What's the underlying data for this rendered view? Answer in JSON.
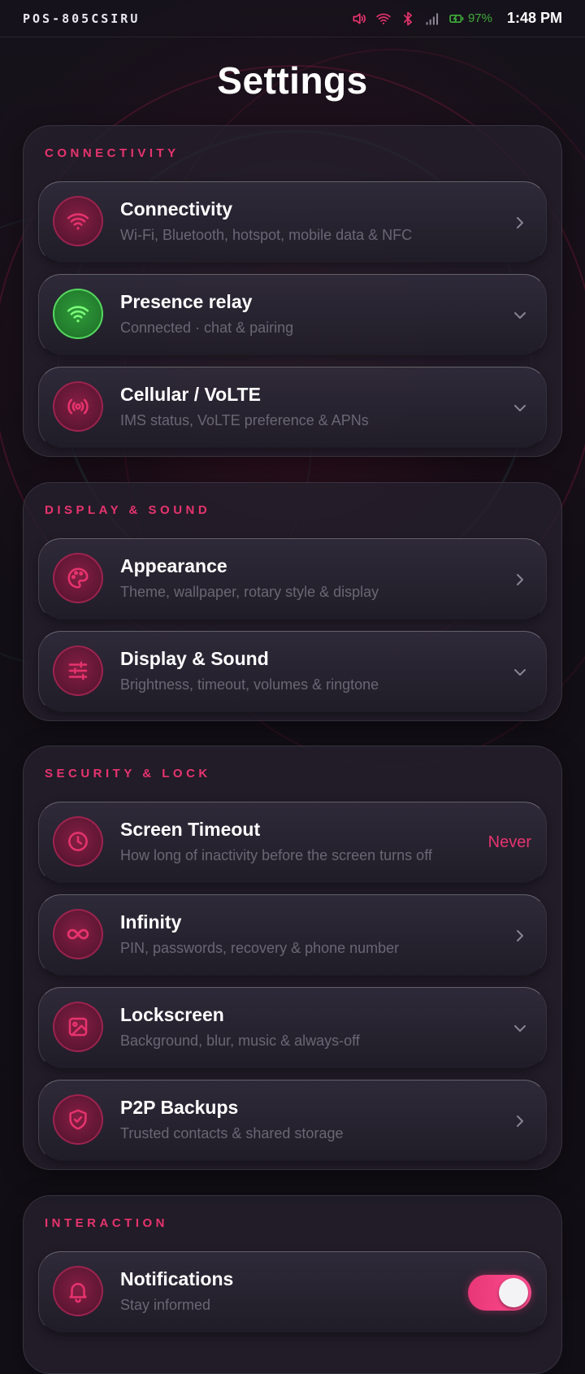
{
  "status_bar": {
    "device_name": "POS-805CSIRU",
    "battery_percent": "97%",
    "time": "1:48 PM",
    "icons": [
      "volume-icon",
      "wifi-icon",
      "bluetooth-icon",
      "signal-icon",
      "battery-charging-icon"
    ],
    "colors": {
      "accent": "#e8336e",
      "battery": "#3fae3a"
    }
  },
  "page": {
    "title": "Settings"
  },
  "sections": [
    {
      "header": "CONNECTIVITY",
      "items": [
        {
          "title": "Connectivity",
          "subtitle": "Wi-Fi, Bluetooth, hotspot, mobile data & NFC",
          "icon": "wifi-icon",
          "trailing": "chevron-right-icon"
        },
        {
          "title": "Presence relay",
          "subtitle": "Connected · chat & pairing",
          "icon": "wifi-icon",
          "icon_color": "#3fae3a",
          "trailing": "chevron-down-icon"
        },
        {
          "title": "Cellular / VoLTE",
          "subtitle": "IMS status, VoLTE preference & APNs",
          "icon": "broadcast-icon",
          "trailing": "chevron-down-icon"
        }
      ]
    },
    {
      "header": "DISPLAY & SOUND",
      "items": [
        {
          "title": "Appearance",
          "subtitle": "Theme, wallpaper, rotary style & display",
          "icon": "palette-icon",
          "trailing": "chevron-right-icon"
        },
        {
          "title": "Display & Sound",
          "subtitle": "Brightness, timeout, volumes & ringtone",
          "icon": "sliders-icon",
          "trailing": "chevron-down-icon"
        }
      ]
    },
    {
      "header": "SECURITY & LOCK",
      "items": [
        {
          "title": "Screen Timeout",
          "subtitle": "How long of inactivity before the screen turns off",
          "icon": "clock-icon",
          "value": "Never"
        },
        {
          "title": "Infinity",
          "subtitle": "PIN, passwords, recovery & phone number",
          "icon": "infinity-icon",
          "trailing": "chevron-right-icon"
        },
        {
          "title": "Lockscreen",
          "subtitle": "Background, blur, music & always-off",
          "icon": "image-icon",
          "trailing": "chevron-down-icon"
        },
        {
          "title": "P2P Backups",
          "subtitle": "Trusted contacts & shared storage",
          "icon": "shield-check-icon",
          "trailing": "chevron-right-icon"
        }
      ]
    },
    {
      "header": "INTERACTION",
      "items": [
        {
          "title": "Notifications",
          "subtitle": "Stay informed",
          "icon": "bell-icon",
          "toggle_on": true
        }
      ]
    }
  ]
}
